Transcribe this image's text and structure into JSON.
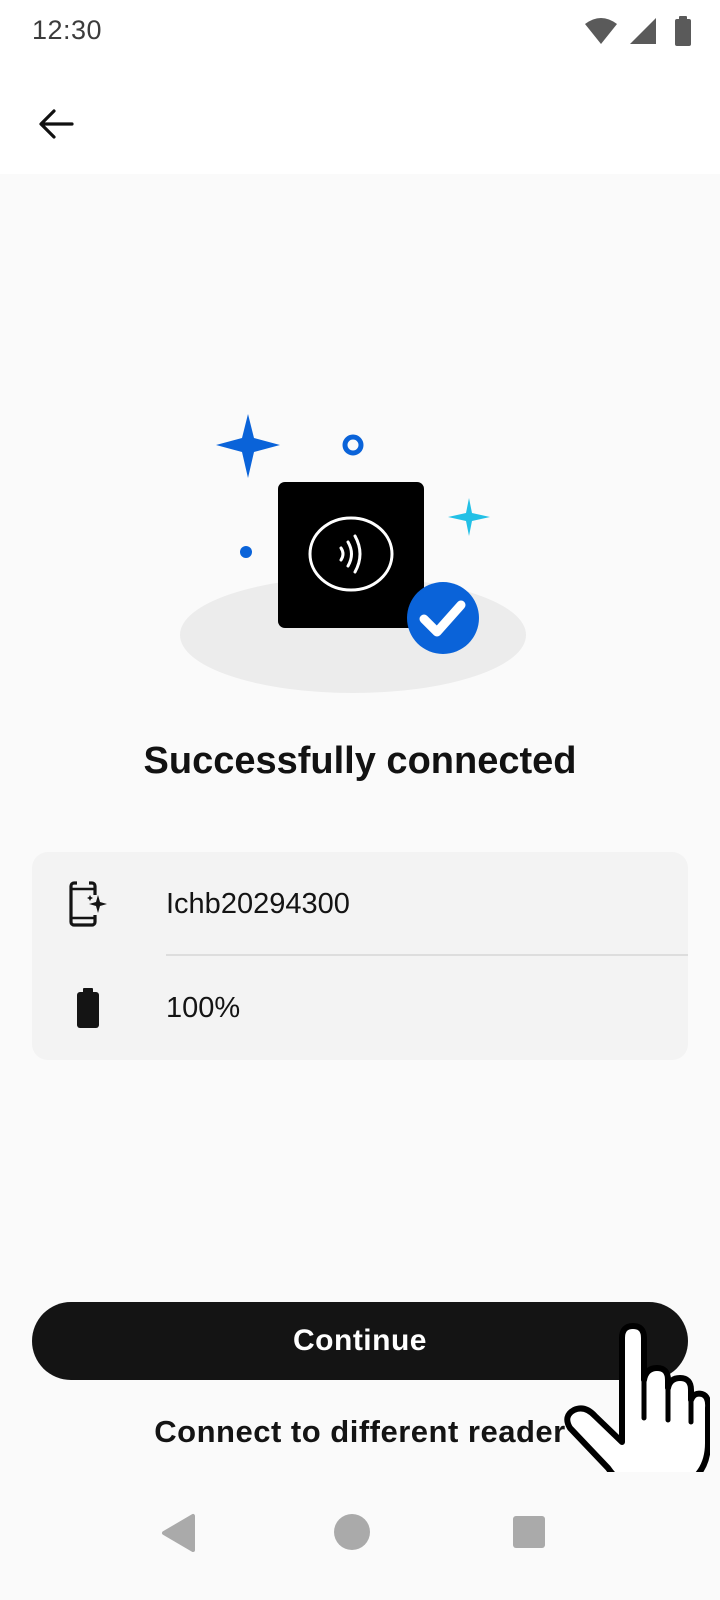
{
  "status_bar": {
    "time": "12:30",
    "icons": [
      "wifi-icon",
      "cellular-signal-icon",
      "battery-icon"
    ]
  },
  "header": {
    "back_icon": "arrow-left-icon"
  },
  "illustration": {
    "icons": [
      "card-reader-icon",
      "contactless-icon",
      "check-circle-icon",
      "sparkle-icon"
    ],
    "colors": {
      "reader": "#000000",
      "check": "#0a63d9",
      "sparkle_blue": "#0a63d9",
      "sparkle_cyan": "#22c0e6",
      "shadow": "#ececec"
    }
  },
  "title": "Successfully connected",
  "reader_info": {
    "name": "Ichb20294300",
    "name_icon": "device-sparkle-icon",
    "battery": "100%",
    "battery_icon": "battery-full-icon"
  },
  "actions": {
    "continue_label": "Continue",
    "secondary_label": "Connect to different reader"
  },
  "nav_bar": {
    "icons": [
      "nav-back-icon",
      "nav-home-icon",
      "nav-recents-icon"
    ]
  },
  "colors": {
    "primary_button": "#141414",
    "background": "#fafafa",
    "card": "#f3f3f3"
  }
}
